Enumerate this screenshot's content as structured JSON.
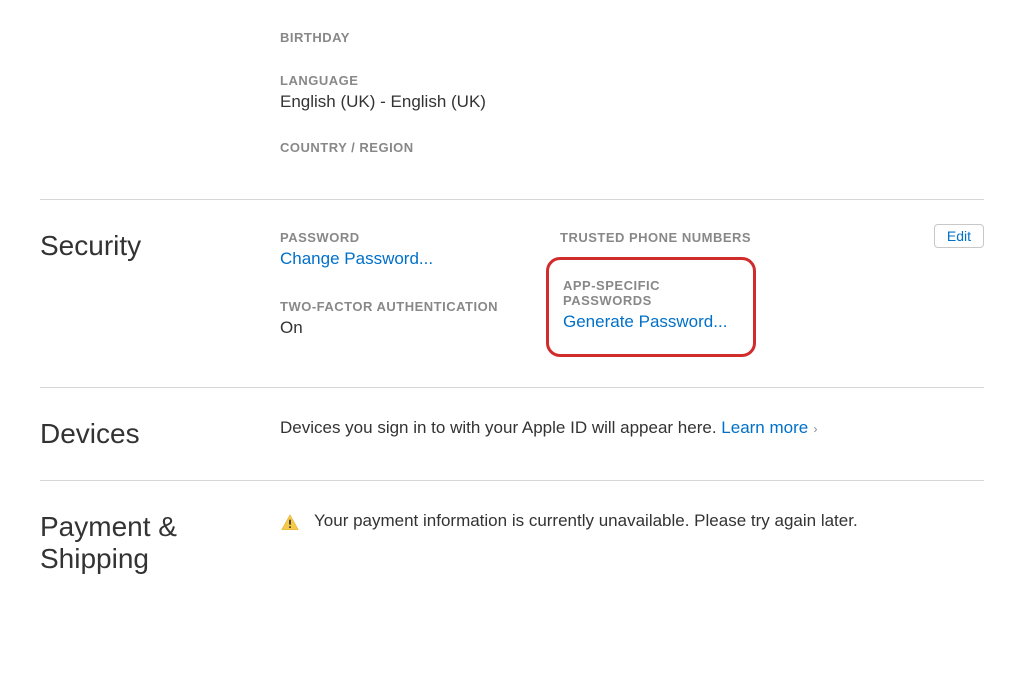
{
  "account": {
    "birthday_label": "BIRTHDAY",
    "language_label": "LANGUAGE",
    "language_value": "English (UK) - English (UK)",
    "country_label": "COUNTRY / REGION"
  },
  "security": {
    "title": "Security",
    "password_label": "PASSWORD",
    "change_password_link": "Change Password...",
    "twofa_label": "TWO-FACTOR AUTHENTICATION",
    "twofa_value": "On",
    "trusted_label": "TRUSTED PHONE NUMBERS",
    "app_specific_label": "APP-SPECIFIC PASSWORDS",
    "generate_link": "Generate Password...",
    "edit_label": "Edit"
  },
  "devices": {
    "title": "Devices",
    "text": "Devices you sign in to with your Apple ID will appear here. ",
    "learn_more": "Learn more"
  },
  "payment": {
    "title": "Payment & Shipping",
    "warning_text": "Your payment information is currently unavailable. Please try again later."
  }
}
